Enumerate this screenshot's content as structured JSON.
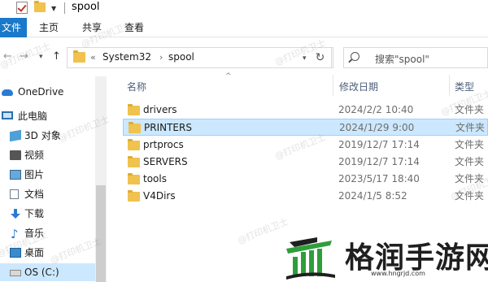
{
  "window": {
    "title": "spool"
  },
  "ribbon": {
    "tabs": [
      "文件",
      "主页",
      "共享",
      "查看"
    ]
  },
  "address": {
    "segments": [
      "System32",
      "spool"
    ]
  },
  "search": {
    "placeholder": "搜索\"spool\""
  },
  "sidebar": {
    "items": [
      {
        "label": "OneDrive",
        "icon": "onedrive-cloud-icon"
      },
      {
        "label": "此电脑",
        "icon": "this-pc-icon"
      },
      {
        "label": "3D 对象",
        "icon": "3d-objects-icon"
      },
      {
        "label": "视频",
        "icon": "video-icon"
      },
      {
        "label": "图片",
        "icon": "pictures-icon"
      },
      {
        "label": "文档",
        "icon": "documents-icon"
      },
      {
        "label": "下载",
        "icon": "downloads-icon"
      },
      {
        "label": "音乐",
        "icon": "music-icon"
      },
      {
        "label": "桌面",
        "icon": "desktop-icon"
      },
      {
        "label": "OS (C:)",
        "icon": "drive-icon"
      }
    ],
    "selected": "OS (C:)"
  },
  "columns": {
    "name": "名称",
    "date": "修改日期",
    "type": "类型"
  },
  "files": [
    {
      "name": "drivers",
      "date": "2024/2/2 10:40",
      "type": "文件夹"
    },
    {
      "name": "PRINTERS",
      "date": "2024/1/29 9:00",
      "type": "文件夹"
    },
    {
      "name": "prtprocs",
      "date": "2019/12/7 17:14",
      "type": "文件夹"
    },
    {
      "name": "SERVERS",
      "date": "2019/12/7 17:14",
      "type": "文件夹"
    },
    {
      "name": "tools",
      "date": "2023/5/17 18:40",
      "type": "文件夹"
    },
    {
      "name": "V4Dirs",
      "date": "2024/1/5 8:52",
      "type": "文件夹"
    }
  ],
  "selected_file": "PRINTERS",
  "watermark": "@打印机卫士",
  "brand": {
    "title": "格润手游网",
    "url": "www.hngrjd.com"
  },
  "colors": {
    "accent": "#1979ca",
    "selection": "#cce8ff",
    "folder": "#f0c24e"
  }
}
